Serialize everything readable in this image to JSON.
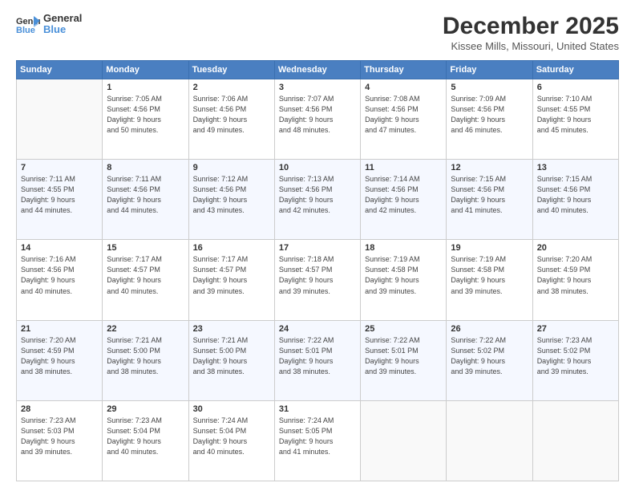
{
  "logo": {
    "line1": "General",
    "line2": "Blue"
  },
  "title": "December 2025",
  "subtitle": "Kissee Mills, Missouri, United States",
  "weekdays": [
    "Sunday",
    "Monday",
    "Tuesday",
    "Wednesday",
    "Thursday",
    "Friday",
    "Saturday"
  ],
  "weeks": [
    [
      {
        "day": "",
        "info": ""
      },
      {
        "day": "1",
        "info": "Sunrise: 7:05 AM\nSunset: 4:56 PM\nDaylight: 9 hours\nand 50 minutes."
      },
      {
        "day": "2",
        "info": "Sunrise: 7:06 AM\nSunset: 4:56 PM\nDaylight: 9 hours\nand 49 minutes."
      },
      {
        "day": "3",
        "info": "Sunrise: 7:07 AM\nSunset: 4:56 PM\nDaylight: 9 hours\nand 48 minutes."
      },
      {
        "day": "4",
        "info": "Sunrise: 7:08 AM\nSunset: 4:56 PM\nDaylight: 9 hours\nand 47 minutes."
      },
      {
        "day": "5",
        "info": "Sunrise: 7:09 AM\nSunset: 4:56 PM\nDaylight: 9 hours\nand 46 minutes."
      },
      {
        "day": "6",
        "info": "Sunrise: 7:10 AM\nSunset: 4:55 PM\nDaylight: 9 hours\nand 45 minutes."
      }
    ],
    [
      {
        "day": "7",
        "info": "Sunrise: 7:11 AM\nSunset: 4:55 PM\nDaylight: 9 hours\nand 44 minutes."
      },
      {
        "day": "8",
        "info": "Sunrise: 7:11 AM\nSunset: 4:56 PM\nDaylight: 9 hours\nand 44 minutes."
      },
      {
        "day": "9",
        "info": "Sunrise: 7:12 AM\nSunset: 4:56 PM\nDaylight: 9 hours\nand 43 minutes."
      },
      {
        "day": "10",
        "info": "Sunrise: 7:13 AM\nSunset: 4:56 PM\nDaylight: 9 hours\nand 42 minutes."
      },
      {
        "day": "11",
        "info": "Sunrise: 7:14 AM\nSunset: 4:56 PM\nDaylight: 9 hours\nand 42 minutes."
      },
      {
        "day": "12",
        "info": "Sunrise: 7:15 AM\nSunset: 4:56 PM\nDaylight: 9 hours\nand 41 minutes."
      },
      {
        "day": "13",
        "info": "Sunrise: 7:15 AM\nSunset: 4:56 PM\nDaylight: 9 hours\nand 40 minutes."
      }
    ],
    [
      {
        "day": "14",
        "info": "Sunrise: 7:16 AM\nSunset: 4:56 PM\nDaylight: 9 hours\nand 40 minutes."
      },
      {
        "day": "15",
        "info": "Sunrise: 7:17 AM\nSunset: 4:57 PM\nDaylight: 9 hours\nand 40 minutes."
      },
      {
        "day": "16",
        "info": "Sunrise: 7:17 AM\nSunset: 4:57 PM\nDaylight: 9 hours\nand 39 minutes."
      },
      {
        "day": "17",
        "info": "Sunrise: 7:18 AM\nSunset: 4:57 PM\nDaylight: 9 hours\nand 39 minutes."
      },
      {
        "day": "18",
        "info": "Sunrise: 7:19 AM\nSunset: 4:58 PM\nDaylight: 9 hours\nand 39 minutes."
      },
      {
        "day": "19",
        "info": "Sunrise: 7:19 AM\nSunset: 4:58 PM\nDaylight: 9 hours\nand 39 minutes."
      },
      {
        "day": "20",
        "info": "Sunrise: 7:20 AM\nSunset: 4:59 PM\nDaylight: 9 hours\nand 38 minutes."
      }
    ],
    [
      {
        "day": "21",
        "info": "Sunrise: 7:20 AM\nSunset: 4:59 PM\nDaylight: 9 hours\nand 38 minutes."
      },
      {
        "day": "22",
        "info": "Sunrise: 7:21 AM\nSunset: 5:00 PM\nDaylight: 9 hours\nand 38 minutes."
      },
      {
        "day": "23",
        "info": "Sunrise: 7:21 AM\nSunset: 5:00 PM\nDaylight: 9 hours\nand 38 minutes."
      },
      {
        "day": "24",
        "info": "Sunrise: 7:22 AM\nSunset: 5:01 PM\nDaylight: 9 hours\nand 38 minutes."
      },
      {
        "day": "25",
        "info": "Sunrise: 7:22 AM\nSunset: 5:01 PM\nDaylight: 9 hours\nand 39 minutes."
      },
      {
        "day": "26",
        "info": "Sunrise: 7:22 AM\nSunset: 5:02 PM\nDaylight: 9 hours\nand 39 minutes."
      },
      {
        "day": "27",
        "info": "Sunrise: 7:23 AM\nSunset: 5:02 PM\nDaylight: 9 hours\nand 39 minutes."
      }
    ],
    [
      {
        "day": "28",
        "info": "Sunrise: 7:23 AM\nSunset: 5:03 PM\nDaylight: 9 hours\nand 39 minutes."
      },
      {
        "day": "29",
        "info": "Sunrise: 7:23 AM\nSunset: 5:04 PM\nDaylight: 9 hours\nand 40 minutes."
      },
      {
        "day": "30",
        "info": "Sunrise: 7:24 AM\nSunset: 5:04 PM\nDaylight: 9 hours\nand 40 minutes."
      },
      {
        "day": "31",
        "info": "Sunrise: 7:24 AM\nSunset: 5:05 PM\nDaylight: 9 hours\nand 41 minutes."
      },
      {
        "day": "",
        "info": ""
      },
      {
        "day": "",
        "info": ""
      },
      {
        "day": "",
        "info": ""
      }
    ]
  ]
}
